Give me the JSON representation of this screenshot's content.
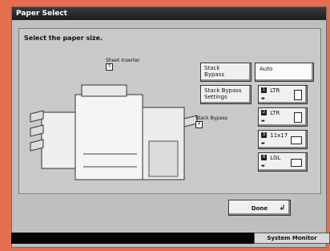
{
  "window": {
    "title": "Paper Select"
  },
  "main": {
    "instruction": "Select the paper size.",
    "callouts": [
      {
        "label": "Sheet Inserter",
        "num": "3"
      },
      {
        "label": "Stack Bypass",
        "num": "4"
      }
    ]
  },
  "controls": {
    "stack_bypass": {
      "line1": "Stack",
      "line2": "Bypass"
    },
    "stack_bypass_settings": {
      "line1": "Stack Bypass",
      "line2": "Settings"
    },
    "auto": "Auto",
    "paper_sizes": [
      {
        "tag": "1",
        "label": "LTR",
        "orientation": "portrait"
      },
      {
        "tag": "2",
        "label": "LTR",
        "orientation": "portrait"
      },
      {
        "tag": "3",
        "label": "11x17",
        "orientation": "landscape"
      },
      {
        "tag": "4",
        "label": "LGL",
        "orientation": "landscape"
      }
    ],
    "done": "Done",
    "system_monitor": "System Monitor"
  }
}
